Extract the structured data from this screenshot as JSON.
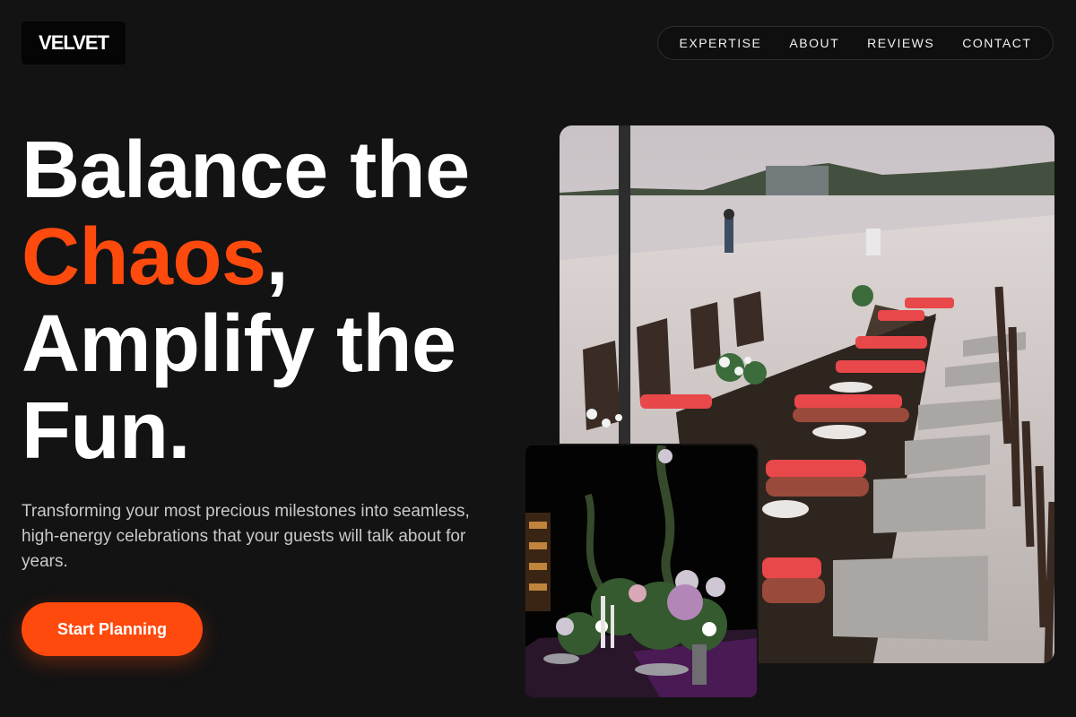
{
  "brand": {
    "logo_text": "VELVET"
  },
  "nav": {
    "items": [
      "EXPERTISE",
      "ABOUT",
      "REVIEWS",
      "CONTACT"
    ]
  },
  "hero": {
    "headline_line1": "Balance the",
    "headline_accent": "Chaos",
    "headline_comma": ",",
    "headline_line3": "Amplify the",
    "headline_line4": "Fun.",
    "subtext": "Transforming your most precious milestones into seamless, high-energy celebrations that your guests will talk about for years.",
    "cta_label": "Start Planning"
  },
  "colors": {
    "accent": "#ff4a0e",
    "background": "#131313",
    "logo_bg": "#050505"
  },
  "images": {
    "main_alt": "Beach wedding banquet table with red napkins and wooden chairs",
    "secondary_alt": "Dark floral table centerpiece with candles"
  }
}
